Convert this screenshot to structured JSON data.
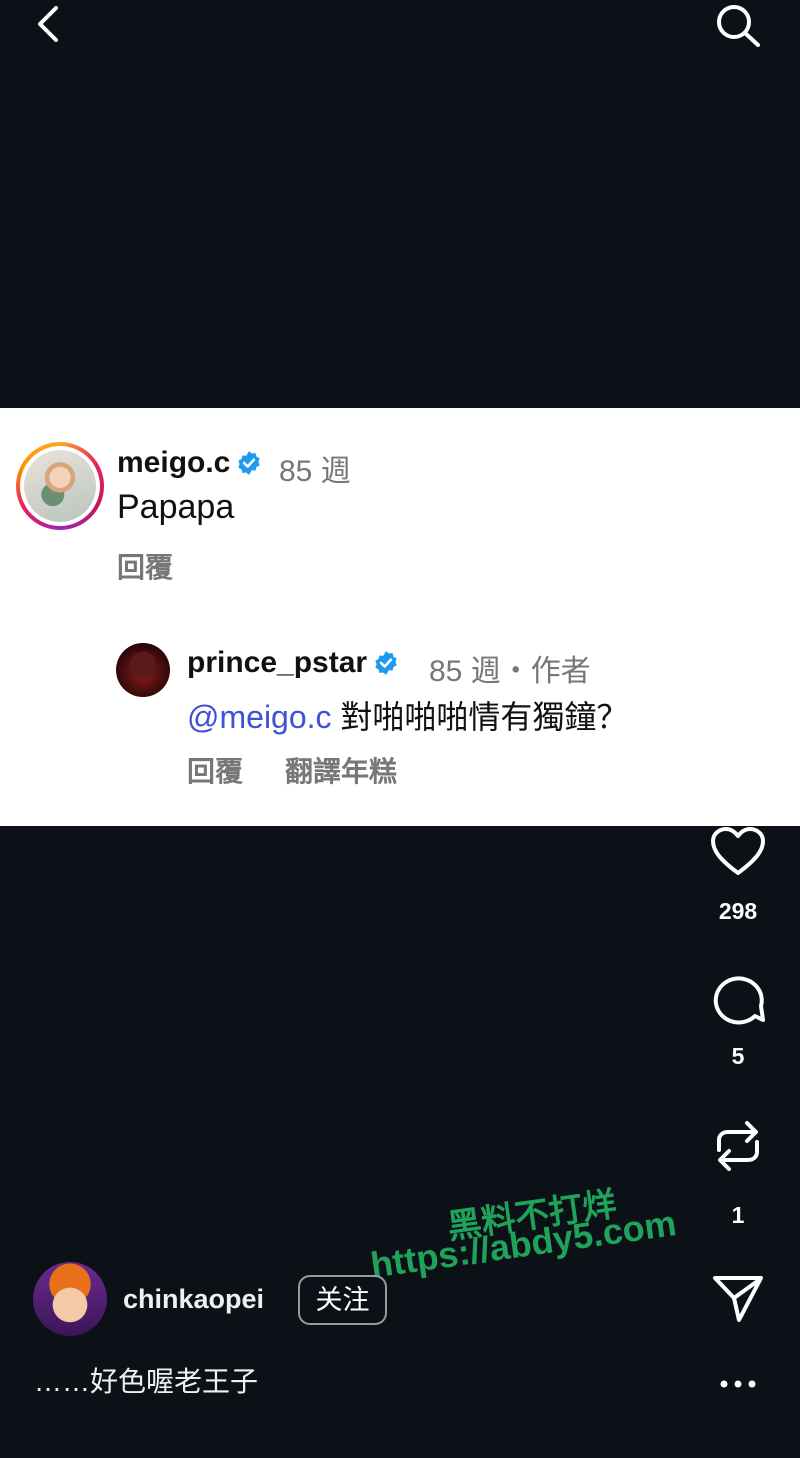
{
  "comment": {
    "username": "meigo.c",
    "time": "85 週",
    "text": "Papapa",
    "reply_label": "回覆"
  },
  "reply": {
    "username": "prince_pstar",
    "time_author": "85 週・作者",
    "mention": "@meigo.c",
    "text": " 對啪啪啪情有獨鐘？",
    "reply_label": "回覆",
    "translate_label": "翻譯年糕"
  },
  "actions": {
    "likes": "298",
    "comments": "5",
    "reposts": "1"
  },
  "watermark": {
    "line1": "黑料不打烊",
    "line2": "https://abdy5.com"
  },
  "post": {
    "username": "chinkaopei",
    "follow_label": "关注",
    "caption": "……好色喔老王子"
  },
  "colors": {
    "background": "#0b1116",
    "card": "#ffffff",
    "verified": "#1d9bf0",
    "mention": "#3f51d6",
    "watermark": "#1fa35a"
  },
  "icons": [
    "back-chevron-icon",
    "search-icon",
    "verified-badge-icon",
    "heart-icon",
    "comment-bubble-icon",
    "repost-icon",
    "share-send-icon",
    "more-dots-icon"
  ]
}
